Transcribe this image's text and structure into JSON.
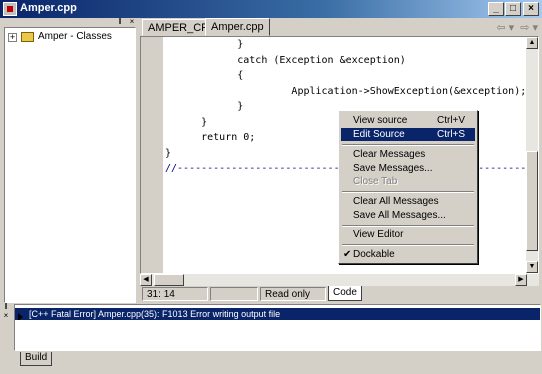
{
  "window": {
    "title": "Amper.cpp",
    "controls": {
      "min": "_",
      "max": "□",
      "close": "×"
    }
  },
  "left_panel": {
    "header_controls": {
      "pin": "‖",
      "close": "×"
    },
    "tree_item": {
      "expand": "+",
      "label": "Amper - Classes"
    }
  },
  "tabs": [
    {
      "label": "AMPER_CPP"
    },
    {
      "label": "Amper.cpp"
    }
  ],
  "nav": {
    "back": "⇦ ▾",
    "forward": "⇨ ▾"
  },
  "code_lines": [
    "            }",
    "            catch (Exception &exception)",
    "            {",
    "                     Application->ShowException(&exception);",
    "            }",
    "      }",
    "      return 0;",
    "}",
    "//---------------------------------------------------------------------------",
    "",
    "",
    "",
    "",
    "",
    ""
  ],
  "status": {
    "line": "31",
    "col": "14",
    "mode": "Read only",
    "code_tab": "Code"
  },
  "messages": {
    "rows": [
      "[C++ Fatal Error] Amper.cpp(35): F1013 Error writing output file"
    ],
    "tab": "Build"
  },
  "context_menu": {
    "items": [
      {
        "label": "View source",
        "shortcut": "Ctrl+V"
      },
      {
        "label": "Edit Source",
        "shortcut": "Ctrl+S",
        "highlighted": true
      },
      {
        "label": "Clear Messages"
      },
      {
        "label": "Save Messages..."
      },
      {
        "label": "Close Tab",
        "disabled": true
      },
      {
        "label": "Clear All Messages"
      },
      {
        "label": "Save All Messages..."
      },
      {
        "label": "View Editor"
      },
      {
        "label": "Dockable",
        "checked": true,
        "check": "✔"
      }
    ]
  },
  "colors": {
    "title_start": "#0a246a",
    "title_end": "#a6caf0",
    "selection": "#0a246a",
    "face": "#d4d0c8"
  },
  "icons": [
    "app-icon",
    "folder-icon",
    "back-arrow-icon",
    "forward-arrow-icon",
    "check-icon",
    "message-arrow-icon"
  ]
}
